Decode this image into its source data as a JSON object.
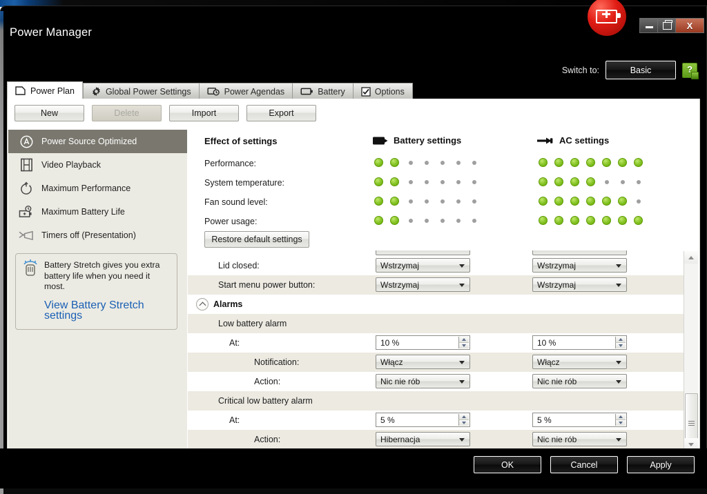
{
  "window": {
    "title": "Power Manager",
    "minimize_label": "Minimize",
    "maximize_label": "Maximize",
    "close_label": "X"
  },
  "header": {
    "switch_to_label": "Switch to:",
    "switch_to_value": "Basic",
    "help_label": "?"
  },
  "tabs": [
    {
      "label": "Power Plan",
      "icon": "page-icon",
      "active": true
    },
    {
      "label": "Global Power Settings",
      "icon": "gear-icon",
      "active": false
    },
    {
      "label": "Power Agendas",
      "icon": "agenda-clock-icon",
      "active": false
    },
    {
      "label": "Battery",
      "icon": "battery-icon",
      "active": false
    },
    {
      "label": "Options",
      "icon": "checkbox-icon",
      "active": false
    }
  ],
  "toolbar": {
    "new_label": "New",
    "delete_label": "Delete",
    "import_label": "Import",
    "export_label": "Export"
  },
  "sidebar": {
    "items": [
      {
        "label": "Power Source Optimized",
        "icon": "auto-a-icon",
        "active": true
      },
      {
        "label": "Video Playback",
        "icon": "film-icon",
        "active": false
      },
      {
        "label": "Maximum Performance",
        "icon": "speed-icon",
        "active": false
      },
      {
        "label": "Maximum Battery Life",
        "icon": "battery-clock-icon",
        "active": false
      },
      {
        "label": "Timers off (Presentation)",
        "icon": "presentation-icon",
        "active": false
      }
    ],
    "promo": {
      "icon": "stretch-hand-icon",
      "text": "Battery Stretch gives you extra battery life when you need it most.",
      "link": "View Battery Stretch settings"
    }
  },
  "effects": {
    "title": "Effect of settings",
    "columns": [
      {
        "label": "Battery settings",
        "icon": "battery-icon"
      },
      {
        "label": "AC settings",
        "icon": "ac-plug-icon"
      }
    ],
    "max_dots": 7,
    "rows": [
      {
        "label": "Performance:",
        "battery": 2,
        "ac": 7
      },
      {
        "label": "System temperature:",
        "battery": 2,
        "ac": 4
      },
      {
        "label": "Fan sound level:",
        "battery": 2,
        "ac": 6
      },
      {
        "label": "Power usage:",
        "battery": 2,
        "ac": 7
      }
    ],
    "restore_label": "Restore default settings",
    "on_color": "#8ac62b",
    "off_color": "#9f9f9f"
  },
  "settings_list": [
    {
      "type": "clipped",
      "alt": false
    },
    {
      "type": "setting",
      "label": "Lid closed:",
      "indent": 1,
      "alt": false,
      "battery": {
        "kind": "select",
        "value": "Wstrzymaj"
      },
      "ac": {
        "kind": "select",
        "value": "Wstrzymaj"
      }
    },
    {
      "type": "setting",
      "label": "Start menu power button:",
      "indent": 1,
      "alt": true,
      "battery": {
        "kind": "select",
        "value": "Wstrzymaj"
      },
      "ac": {
        "kind": "select",
        "value": "Wstrzymaj"
      }
    },
    {
      "type": "group",
      "label": "Alarms",
      "expanded": true
    },
    {
      "type": "header",
      "label": "Low battery alarm",
      "indent": 1,
      "alt": true
    },
    {
      "type": "setting",
      "label": "At:",
      "indent": 2,
      "alt": false,
      "battery": {
        "kind": "spin",
        "value": "10 %"
      },
      "ac": {
        "kind": "spin",
        "value": "10 %"
      }
    },
    {
      "type": "setting",
      "label": "Notification:",
      "indent": 3,
      "alt": true,
      "battery": {
        "kind": "select",
        "value": "Włącz"
      },
      "ac": {
        "kind": "select",
        "value": "Włącz"
      }
    },
    {
      "type": "setting",
      "label": "Action:",
      "indent": 3,
      "alt": false,
      "battery": {
        "kind": "select",
        "value": "Nic nie rób"
      },
      "ac": {
        "kind": "select",
        "value": "Nic nie rób"
      }
    },
    {
      "type": "header",
      "label": "Critical low battery alarm",
      "indent": 1,
      "alt": true
    },
    {
      "type": "setting",
      "label": "At:",
      "indent": 2,
      "alt": false,
      "battery": {
        "kind": "spin",
        "value": "5 %"
      },
      "ac": {
        "kind": "spin",
        "value": "5 %"
      }
    },
    {
      "type": "setting",
      "label": "Action:",
      "indent": 3,
      "alt": true,
      "battery": {
        "kind": "select",
        "value": "Hibernacja"
      },
      "ac": {
        "kind": "select",
        "value": "Nic nie rób"
      }
    }
  ],
  "scrollbar": {
    "up_icon": "scroll-up-arrow-icon",
    "down_icon": "scroll-down-arrow-icon"
  },
  "footer": {
    "ok_label": "OK",
    "cancel_label": "Cancel",
    "apply_label": "Apply"
  }
}
